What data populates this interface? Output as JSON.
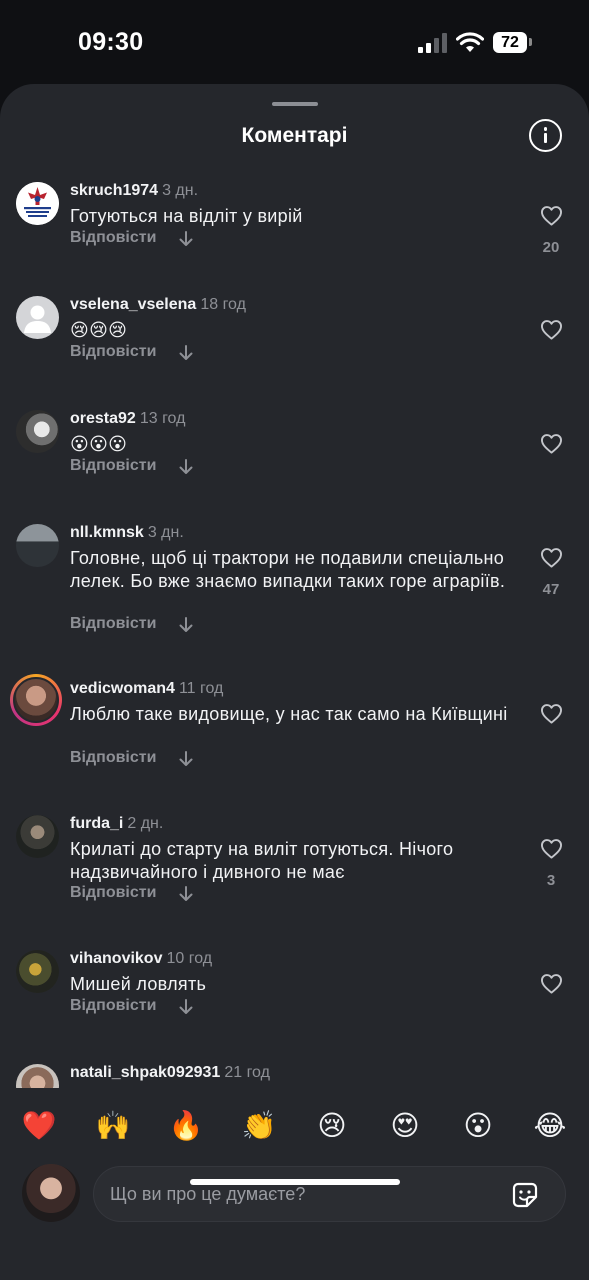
{
  "status": {
    "time": "09:30",
    "battery": "72"
  },
  "sheet": {
    "title": "Коментарі"
  },
  "comments": [
    {
      "user": "skruch1974",
      "time": "3 дн.",
      "text": "Готуються на відліт у вирій",
      "likes": "20",
      "avatar_text": "СЛАВА ЗБРОЙНИМ СИЛАМ УКРАЇНИ"
    },
    {
      "user": "vselena_vselena",
      "time": "18 год",
      "text": "😢😢😢",
      "likes": ""
    },
    {
      "user": "oresta92",
      "time": "13 год",
      "text": "😮😮😮",
      "likes": ""
    },
    {
      "user": "nll.kmnsk",
      "time": "3 дн.",
      "text": "Головне, щоб ці трактори не подавили спеціально лелек. Бо вже знаємо випадки таких горе аграріїв.",
      "likes": "47"
    },
    {
      "user": "vedicwoman4",
      "time": "11 год",
      "text": "Люблю таке видовище, у нас так само на Київщині",
      "likes": ""
    },
    {
      "user": "furda_i",
      "time": "2 дн.",
      "text": "Крилаті до старту на виліт готуються. Нічого надзвичайного і дивного не має",
      "likes": "3"
    },
    {
      "user": "vihanovikov",
      "time": "10 год",
      "text": "Мишей ловлять",
      "likes": ""
    },
    {
      "user": "natali_shpak092931",
      "time": "21 год",
      "text": "",
      "likes": ""
    }
  ],
  "reply_label": "Відповісти",
  "emoji_bar": [
    "❤️",
    "🙌",
    "🔥",
    "👏",
    "😢",
    "😍",
    "😮",
    "😂"
  ],
  "composer": {
    "placeholder": "Що ви про це думаєте?"
  },
  "colors": {
    "background": "#0f1013",
    "sheet": "#25272c",
    "secondary_text": "#8e9096"
  }
}
